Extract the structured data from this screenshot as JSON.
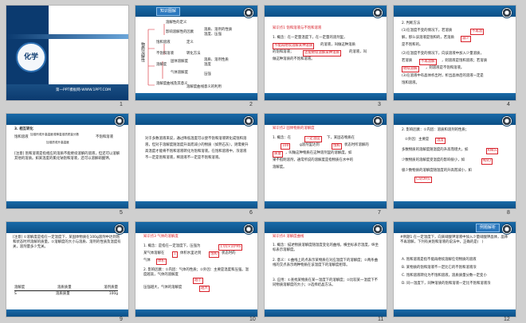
{
  "slides": [
    {
      "num": "1",
      "title": "7.2 物质溶解的量",
      "circle_label": "化学",
      "footer": "第一PPT模板网-WWW.1PPT.COM"
    },
    {
      "num": "2",
      "tag": "知识图解",
      "tree_lines": [
        "溶解性的定义",
        "影响溶解性的因素",
        "溶质、溶剂的性质",
        "温度、压强",
        "饱和溶液",
        "不饱和溶液",
        "定义",
        "转化方法",
        "溶解度",
        "温度",
        "固体溶解度",
        "气体溶解度",
        "溶解度曲线及其意义",
        "溶质、溶剂性质",
        "压强",
        "溶解度曲线意义的利用"
      ],
      "root": "物质溶解性"
    },
    {
      "num": "3",
      "section": "知识点1 饱和溶液与不饱和溶液",
      "line1": "1. 概念：在一定量温度下，在一定量的溶剂里，",
      "blank1": "不能再继续溶解某种溶质",
      "line1b": "的溶液，叫做这种溶质",
      "line2": "的饱和溶液；",
      "blank2": "还能继续溶解某种溶质",
      "line2b": "的溶液，叫",
      "line3": "做这种溶质的不饱和溶液。"
    },
    {
      "num": "4",
      "line1": "2. 判断方法",
      "line2": "(1)在温度不变的情况下，若溶质",
      "blank1": "不再溶",
      "line3": "解，那么该溶液是饱和的，若溶质",
      "blank2": "减少",
      "line3b": "，那么该溶液",
      "line4": "是不饱和的。",
      "line5": "(2)在温度不变的情况下，向该溶液中加入少量溶质，",
      "line6": "若溶质",
      "blank3": "不再溶解",
      "line6b": "，则溶液是饱和溶液；若溶质",
      "blank4": "继续溶解",
      "line7": "，则溶液是不饱和溶液。",
      "line8": "(3)在溶液中有晶体析出时，析出晶体后的溶液一定是",
      "line9": "饱和溶液。"
    },
    {
      "num": "5",
      "head": "3. 相互转化",
      "left_lbl": "饱和溶液",
      "right_lbl": "不饱和溶液",
      "up": "加溶剂或升高温度或降温溶质质量分数",
      "down": "加溶质或升高温度",
      "note": "[注意] 饱和溶液是指相应的溶质不能继续溶解的溶液，但还可以溶解其他的溶质。如某温度的氯化钠饱和溶液，还可以溶解硝酸钾。"
    },
    {
      "num": "6",
      "body": "对于多数溶液来说，通过降低温度可以使不饱和溶液转化成饱和溶液，但对于溶解度随温度升高而减小的物质（如熟石灰），则需要升高温度才能将不饱和溶液转化为饱和溶液。在饱和溶液中，浓溶液不一定是饱和溶液，稀溶液不一定是不饱和溶液。"
    },
    {
      "num": "7",
      "section": "知识点2 固体物质的溶解度",
      "line1": "1. 概念：在",
      "blank1": "一定温度",
      "line1b": "下，某固态物质在",
      "blank2": "100",
      "line2": "g溶剂里达到",
      "blank3": "饱和",
      "line2b": "状态时所溶解的",
      "blank4": "质量",
      "line3": "，叫做这种物质在这种溶剂里的溶解度。如",
      "line4": "果不指明溶剂，通常所说的溶解度是指物质在水中的",
      "line5": "溶解度。"
    },
    {
      "num": "8",
      "line1": "2. 影响因素：①内因：溶质和溶剂的性质；",
      "line2": "②外因：主要是",
      "blank1": "温度",
      "line3": "多数物质的溶解度随温度的升高而增大，如",
      "blank2": "KNO₃",
      "line4": "少数物质的溶解度受温度的影响很小，如",
      "blank3": "NaCl",
      "line5": "极少数物质的溶解度随温度的升高而减小，如",
      "blank4": "Ca(OH)₂"
    },
    {
      "num": "9",
      "body": "[注意] ①溶解度是指在一定温度下，某固体物质在100g溶剂中达到饱和状态时所溶解的质量。②溶解度的大小与溶质、溶剂的性质及温度有关，溶剂量多少无关。",
      "t_head": [
        "溶解度",
        "溶质质量",
        "溶剂质量"
      ],
      "t_row": [
        "S",
        "溶质质量",
        "100g"
      ]
    },
    {
      "num": "10",
      "section": "知识点3 气体的溶解度",
      "line1": "1. 概念：是指在一定温度下，压强为",
      "blank1": "1.01×10⁵Pa",
      "line1b": "时，",
      "line2": "某气体溶解在",
      "blank2": "1",
      "line2b": "体积水里达到",
      "blank3": "饱和",
      "line2c": "状态时的",
      "line3": "气体",
      "blank4": "体积",
      "line4": "2. 影响因素：①内因：气体的性质；②外因：主要是温度和压强。温度越高，气体的溶解度",
      "blank5": "越小",
      "line5": "压强越大，气体的溶解度",
      "blank6": "越大"
    },
    {
      "num": "11",
      "section": "知识点4 溶解度曲线",
      "line1": "1. 概念：描述物质溶解度随温度变化的曲线，横坐标表示温度，纵坐标表示溶解度。",
      "line2": "2. 意义：①曲线上的点表示某物质在对应温度下的溶解度；②两条曲线的交点表示两种物质在该温度下的溶解度相等。",
      "line3": "3. 应用：①查找某物质在某一温度下的溶解度；②比较某一温度下不同物质溶解度的大小；③选择结晶方法。"
    },
    {
      "num": "12",
      "tag": "例题解析",
      "line1": "#例题1 在一定温度下，向某硝酸钾溶液中加入少量硝酸钾晶体，晶体不再溶解，下列有关饱和溶液的说法中，正确的是(　)",
      "opt_a": "A. 饱和溶液是指不能再继续溶解任何物质的溶液",
      "opt_b": "B. 某物质的饱和溶液不一定比它的不饱和溶液浓",
      "opt_c": "C. 饱和溶液转化为不饱和溶液，溶质质量分数一定变小",
      "opt_d": "D. 同一温度下，同种溶质的饱和溶液一定比不饱和溶液浓"
    }
  ],
  "nav": {
    "a": "知识点解析",
    "b": "知识点复习",
    "c": "典型题"
  },
  "tags": {
    "knowledge": "知识图解"
  }
}
